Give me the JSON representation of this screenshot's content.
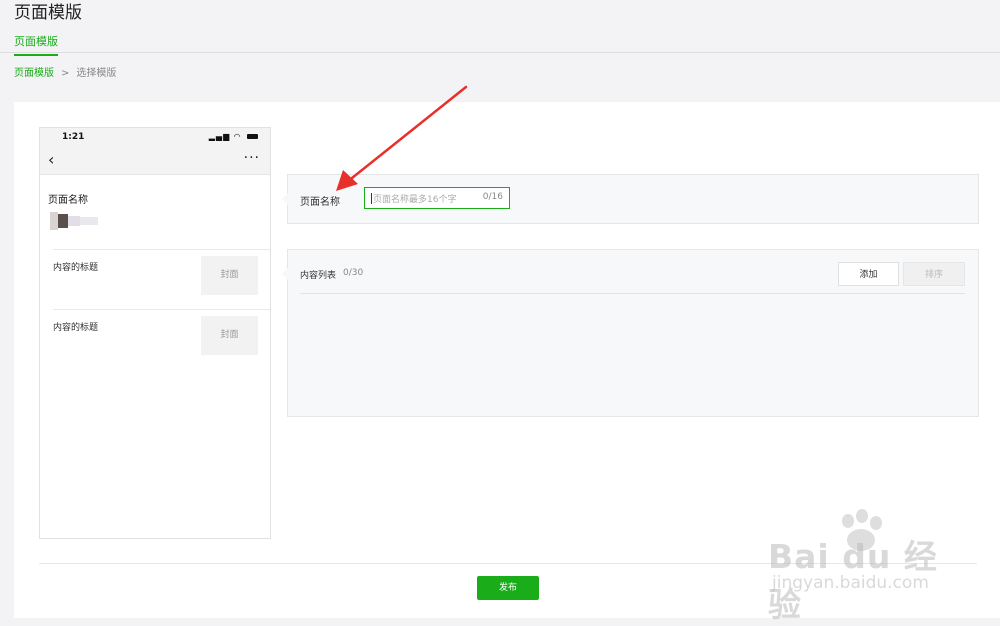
{
  "header": {
    "title": "页面模版"
  },
  "tabs": [
    {
      "label": "页面模版",
      "active": true
    }
  ],
  "breadcrumb": {
    "root": "页面模版",
    "separator": ">",
    "current": "选择模版"
  },
  "phone": {
    "time": "1:21",
    "status_icons": "signal wifi battery",
    "back_icon": "‹",
    "more_icon": "···",
    "page_name": "页面名称",
    "articles": [
      {
        "title": "内容的标题",
        "cover": "封面"
      },
      {
        "title": "内容的标题",
        "cover": "封面"
      }
    ]
  },
  "form": {
    "name_label": "页面名称",
    "name_placeholder": "页面名称最多16个字",
    "name_counter": "0/16",
    "list_label": "内容列表",
    "list_count": "0/30",
    "add_button": "添加",
    "sort_button": "排序"
  },
  "footer": {
    "publish_button": "发布"
  },
  "watermark": {
    "text": "Bai du 经验",
    "sub": "jingyan.baidu.com"
  },
  "colors": {
    "accent": "#1aad19",
    "arrow": "#e8302b",
    "card_bg": "#f7f8fa"
  }
}
